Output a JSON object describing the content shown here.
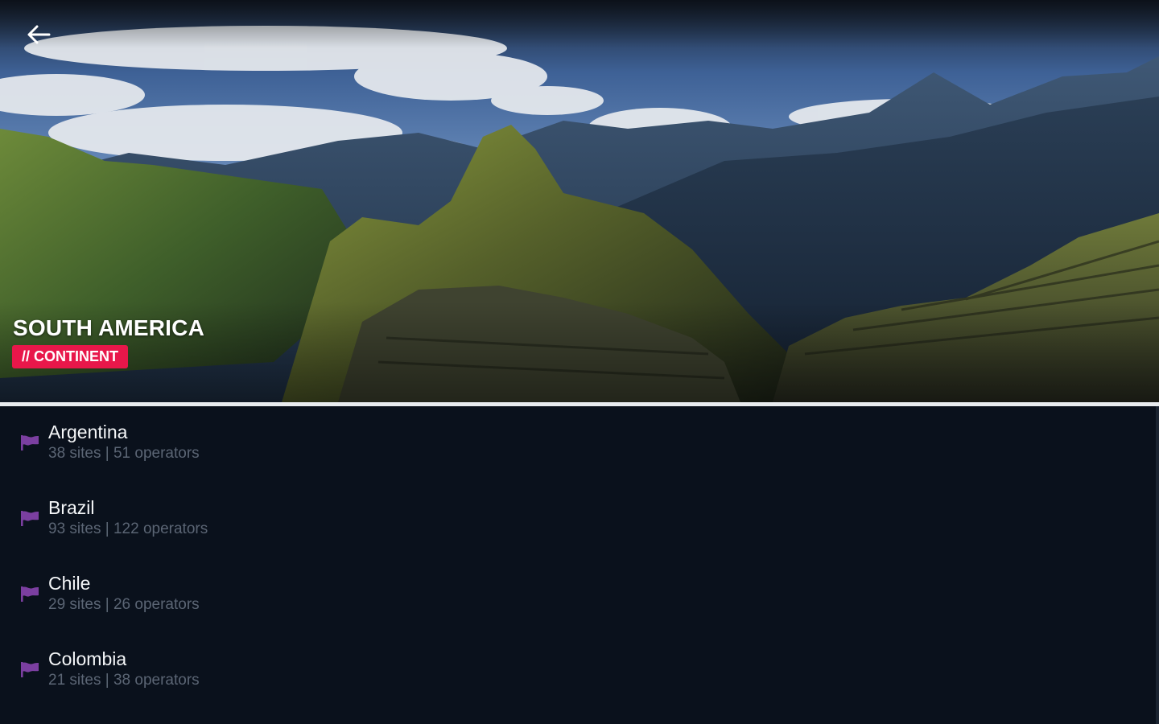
{
  "header": {
    "title": "SOUTH AMERICA",
    "badge": "// CONTINENT",
    "back_icon": "arrow-left-icon"
  },
  "colors": {
    "badge": "#e8174a",
    "flag": "#7b3fa0",
    "background": "#0a111c"
  },
  "countries": [
    {
      "name": "Argentina",
      "meta": "38 sites | 51 operators",
      "icon": "flag-icon"
    },
    {
      "name": "Brazil",
      "meta": "93 sites | 122 operators",
      "icon": "flag-icon"
    },
    {
      "name": "Chile",
      "meta": "29 sites | 26 operators",
      "icon": "flag-icon"
    },
    {
      "name": "Colombia",
      "meta": "21 sites | 38 operators",
      "icon": "flag-icon"
    }
  ]
}
